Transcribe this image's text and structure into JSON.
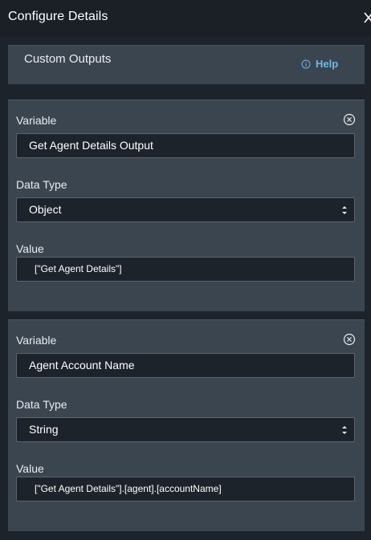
{
  "window": {
    "title": "Configure Details"
  },
  "header": {
    "title": "Custom Outputs",
    "help_label": "Help"
  },
  "outputs": [
    {
      "variable_label": "Variable",
      "variable_value": "Get Agent Details Output",
      "data_type_label": "Data Type",
      "data_type_value": "Object",
      "value_label": "Value",
      "value_value": "[\"Get Agent Details\"]"
    },
    {
      "variable_label": "Variable",
      "variable_value": "Agent Account Name",
      "data_type_label": "Data Type",
      "data_type_value": "String",
      "value_label": "Value",
      "value_value": "[\"Get Agent Details\"].[agent].[accountName]"
    }
  ],
  "colors": {
    "background": "#1d232a",
    "card": "#3b4550",
    "accent_link": "#6fb8e8"
  },
  "icons": {
    "close": "close-icon",
    "help": "info-icon",
    "remove": "remove-circle-icon",
    "select_caret": "select-caret-icon"
  }
}
